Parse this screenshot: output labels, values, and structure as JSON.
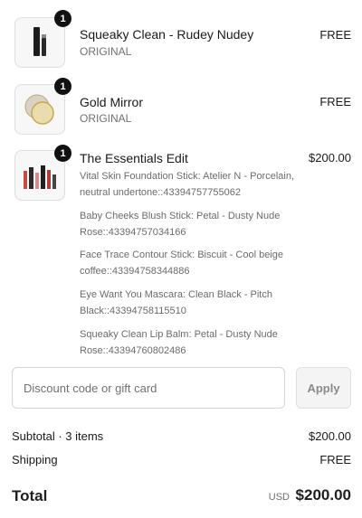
{
  "items": [
    {
      "name": "Squeaky Clean - Rudey Nudey",
      "variant": "ORIGINAL",
      "price": "FREE",
      "quantity": "1",
      "image_icon": "lipstick-tube-icon"
    },
    {
      "name": "Gold Mirror",
      "variant": "ORIGINAL",
      "price": "FREE",
      "quantity": "1",
      "image_icon": "compact-mirror-icon"
    },
    {
      "name": "The Essentials Edit",
      "price": "$200.00",
      "quantity": "1",
      "image_icon": "makeup-set-icon",
      "components": [
        "Vital Skin Foundation Stick: Atelier N - Porcelain, neutral undertone::43394757755062",
        "Baby Cheeks Blush Stick: Petal - Dusty Nude Rose::43394757034166",
        "Face Trace Contour Stick: Biscuit - Cool beige coffee::43394758344886",
        "Eye Want You Mascara: Clean Black - Pitch Black::43394758115510",
        "Squeaky Clean Lip Balm: Petal - Dusty Nude Rose::43394760802486"
      ]
    }
  ],
  "discount": {
    "placeholder": "Discount code or gift card",
    "apply_label": "Apply"
  },
  "summary": {
    "subtotal_label": "Subtotal · 3 items",
    "subtotal_value": "$200.00",
    "shipping_label": "Shipping",
    "shipping_value": "FREE",
    "total_label": "Total",
    "total_currency": "USD",
    "total_value": "$200.00"
  }
}
